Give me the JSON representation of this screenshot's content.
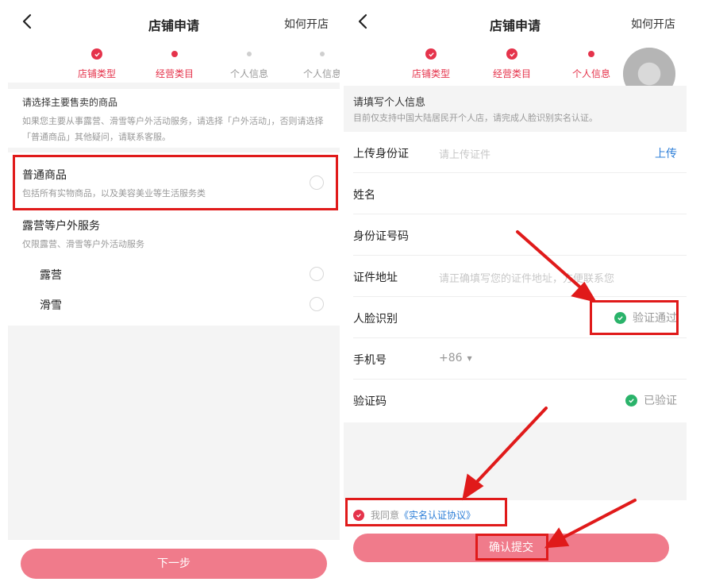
{
  "colors": {
    "accent": "#e5334b",
    "button": "#f07b8b",
    "link": "#2e7fd8",
    "success": "#2ab36a",
    "annotation": "#e01a1a"
  },
  "left": {
    "header": {
      "title": "店铺申请",
      "how_link": "如何开店"
    },
    "steps": [
      {
        "label": "店铺类型",
        "state": "done"
      },
      {
        "label": "经营类目",
        "state": "active"
      },
      {
        "label": "个人信息",
        "state": "inactive"
      },
      {
        "label": "个人信息",
        "state": "inactive"
      }
    ],
    "intro": {
      "title": "请选择主要售卖的商品",
      "desc": "如果您主要从事露营、滑雪等户外活动服务，请选择「户外活动」，否则请选择「普通商品」其他疑问，请联系客服。"
    },
    "option_general": {
      "title": "普通商品",
      "subtitle": "包括所有实物商品，以及美容美业等生活服务类"
    },
    "option_outdoor": {
      "title": "露营等户外服务",
      "subtitle": "仅限露营、滑雪等户外活动服务"
    },
    "sub_options": [
      "露营",
      "滑雪"
    ],
    "next_button": "下一步"
  },
  "right": {
    "header": {
      "title": "店铺申请",
      "how_link": "如何开店"
    },
    "steps": [
      {
        "label": "店铺类型",
        "state": "done"
      },
      {
        "label": "经营类目",
        "state": "done"
      },
      {
        "label": "个人信息",
        "state": "active"
      }
    ],
    "intro": {
      "title": "请填写个人信息",
      "desc": "目前仅支持中国大陆居民开个人店，请完成人脸识别实名认证。"
    },
    "rows": {
      "id_upload": {
        "label": "上传身份证",
        "placeholder": "请上传证件",
        "action": "上传"
      },
      "name": {
        "label": "姓名"
      },
      "id_number": {
        "label": "身份证号码"
      },
      "address": {
        "label": "证件地址",
        "placeholder": "请正确填写您的证件地址，方便联系您"
      },
      "face": {
        "label": "人脸识别",
        "status": "验证通过"
      },
      "phone": {
        "label": "手机号",
        "prefix": "+86"
      },
      "code": {
        "label": "验证码",
        "status": "已验证"
      }
    },
    "agree": {
      "prefix": "我同意",
      "link": "《实名认证协议》"
    },
    "submit_button": "确认提交"
  }
}
